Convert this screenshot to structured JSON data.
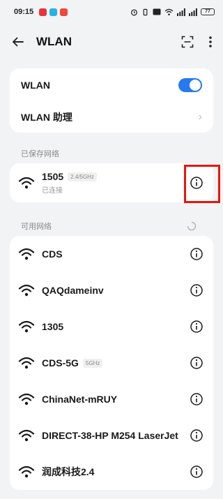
{
  "status": {
    "time": "09:15",
    "battery": "77"
  },
  "header": {
    "title": "WLAN"
  },
  "settings": {
    "wlan_label": "WLAN",
    "assistant_label": "WLAN 助理"
  },
  "saved": {
    "section_title": "已保存网络",
    "network": {
      "name": "1505",
      "band": "2.4/5GHz",
      "status": "已连接"
    }
  },
  "available": {
    "section_title": "可用网络",
    "networks": [
      {
        "name": "CDS",
        "band": ""
      },
      {
        "name": "QAQdameinv",
        "band": ""
      },
      {
        "name": "1305",
        "band": ""
      },
      {
        "name": "CDS-5G",
        "band": "5GHz"
      },
      {
        "name": "ChinaNet-mRUY",
        "band": ""
      },
      {
        "name": "DIRECT-38-HP M254 LaserJet",
        "band": ""
      },
      {
        "name": "润成科技2.4",
        "band": ""
      }
    ]
  },
  "colors": {
    "accent": "#2878f0",
    "highlight": "#e8160c",
    "background": "#f2f3f5"
  }
}
